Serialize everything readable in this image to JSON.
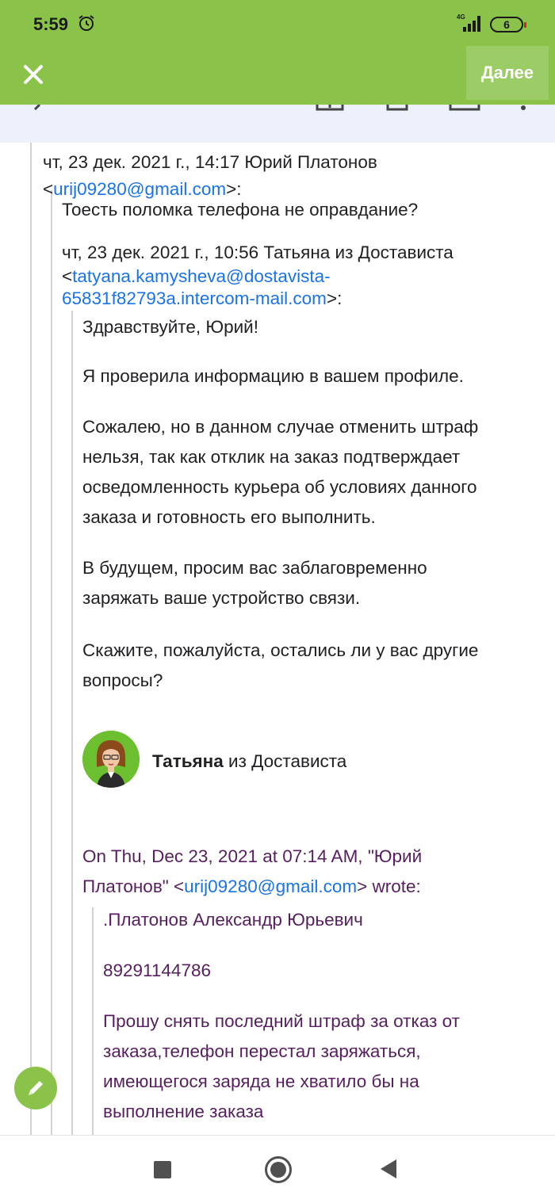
{
  "status_bar": {
    "time": "5:59",
    "network": "4G",
    "battery_level": "6",
    "icons": [
      "alarm-icon",
      "signal-icon",
      "battery-icon"
    ]
  },
  "app_bar": {
    "close_icon": "close-icon",
    "next_label": "Далее",
    "accent_color": "#8bc34a"
  },
  "thread": {
    "q1": {
      "header_date": "чт, 23 дек. 2021 г., 14:17 Юрий Платонов",
      "header_open": "<",
      "email": "urij09280@gmail.com",
      "header_close": ">:",
      "body": "Тоесть поломка телефона не оправдание?"
    },
    "q2": {
      "header_date": "чт, 23 дек. 2021 г., 10:56 Татьяна из Достависта",
      "header_open": "<",
      "email_line1": "tatyana.kamysheva@dostavista-",
      "email_line2": "65831f82793a.intercom-mail.com",
      "header_close": ">:",
      "greeting": "Здравствуйте, Юрий!",
      "p1": "Я проверила информацию в вашем профиле.",
      "p2_lines": [
        "Сожалею, но в данном случае отменить штраф",
        "нельзя, так как отклик на заказ подтверждает",
        "осведомленность курьера об условиях данного",
        "заказа и готовность его выполнить."
      ],
      "p3_lines": [
        "В будущем, просим вас заблаговременно",
        "заряжать ваше устройство связи."
      ],
      "p4_lines": [
        "Скажите, пожалуйста, остались ли у вас другие",
        "вопросы?"
      ],
      "signature_name": "Татьяна",
      "signature_rest": " из Достависта",
      "wrote_line1": "On Thu, Dec 23, 2021 at 07:14 AM, \"Юрий",
      "wrote_line2_pre": "Платонов\" <",
      "wrote_email": "urij09280@gmail.com",
      "wrote_line2_post": "> wrote:"
    },
    "q3": {
      "name": ".Платонов Александр Юрьевич",
      "phone": "89291144786",
      "request_lines": [
        "Прошу снять последний штраф за отказ от",
        "заказа,телефон перестал заряжаться,",
        "имеющегося заряда не хватило бы на",
        "выполнение заказа"
      ]
    }
  },
  "fab": {
    "icon": "pencil-icon"
  },
  "nav": {
    "icons": [
      "recents-icon",
      "home-icon",
      "back-icon"
    ]
  }
}
